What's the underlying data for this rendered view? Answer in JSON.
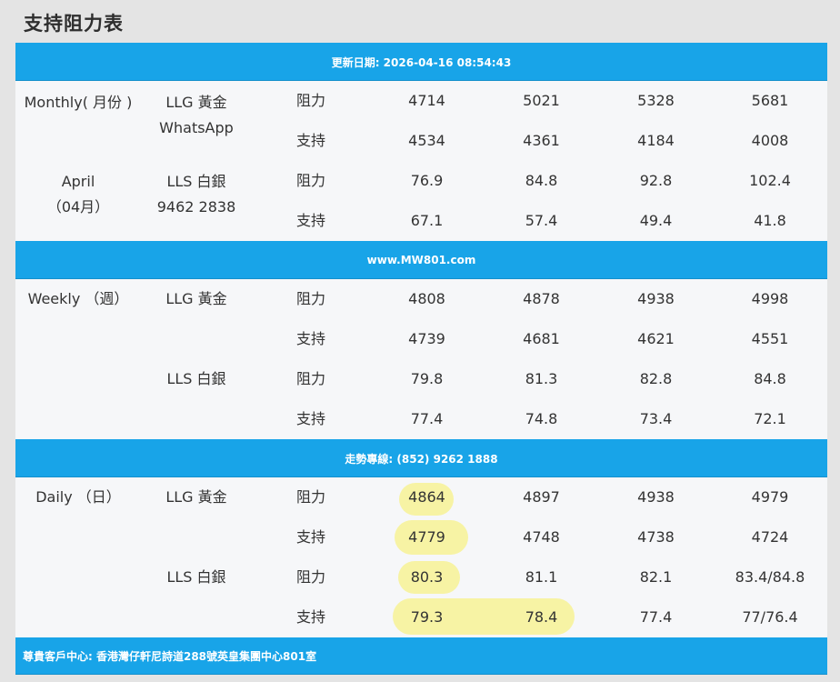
{
  "page_title": "支持阻力表",
  "bands": {
    "updated": "更新日期: 2026-04-16 08:54:43",
    "website": "www.MW801.com",
    "hotline": "走勢專線: (852) 9262 1888",
    "address": "尊貴客戶中心: 香港灣仔軒尼詩道288號英皇集團中心801室"
  },
  "monthly": {
    "period": [
      "Monthly( 月份 )",
      "April",
      "（04月）"
    ],
    "contact": [
      "WhatsApp",
      "9462 2838"
    ],
    "rows": [
      {
        "product": "LLG 黃金",
        "type": "阻力",
        "values": [
          "4714",
          "5021",
          "5328",
          "5681"
        ]
      },
      {
        "product": "",
        "type": "支持",
        "values": [
          "4534",
          "4361",
          "4184",
          "4008"
        ]
      },
      {
        "product": "LLS 白銀",
        "type": "阻力",
        "values": [
          "76.9",
          "84.8",
          "92.8",
          "102.4"
        ]
      },
      {
        "product": "",
        "type": "支持",
        "values": [
          "67.1",
          "57.4",
          "49.4",
          "41.8"
        ]
      }
    ]
  },
  "weekly": {
    "period": "Weekly （週）",
    "rows": [
      {
        "product": "LLG 黃金",
        "type": "阻力",
        "values": [
          "4808",
          "4878",
          "4938",
          "4998"
        ]
      },
      {
        "product": "",
        "type": "支持",
        "values": [
          "4739",
          "4681",
          "4621",
          "4551"
        ]
      },
      {
        "product": "LLS 白銀",
        "type": "阻力",
        "values": [
          "79.8",
          "81.3",
          "82.8",
          "84.8"
        ]
      },
      {
        "product": "",
        "type": "支持",
        "values": [
          "77.4",
          "74.8",
          "73.4",
          "72.1"
        ]
      }
    ]
  },
  "daily": {
    "period": "Daily （日）",
    "rows": [
      {
        "product": "LLG 黃金",
        "type": "阻力",
        "values": [
          "4864",
          "4897",
          "4938",
          "4979"
        ]
      },
      {
        "product": "",
        "type": "支持",
        "values": [
          "4779",
          "4748",
          "4738",
          "4724"
        ]
      },
      {
        "product": "LLS 白銀",
        "type": "阻力",
        "values": [
          "80.3",
          "81.1",
          "82.1",
          "83.4/84.8"
        ]
      },
      {
        "product": "",
        "type": "支持",
        "values": [
          "79.3",
          "78.4",
          "77.4",
          "77/76.4"
        ]
      }
    ]
  },
  "colors": {
    "band": "#18a4e8",
    "highlight": "#f7f3a4",
    "text": "#333333"
  }
}
